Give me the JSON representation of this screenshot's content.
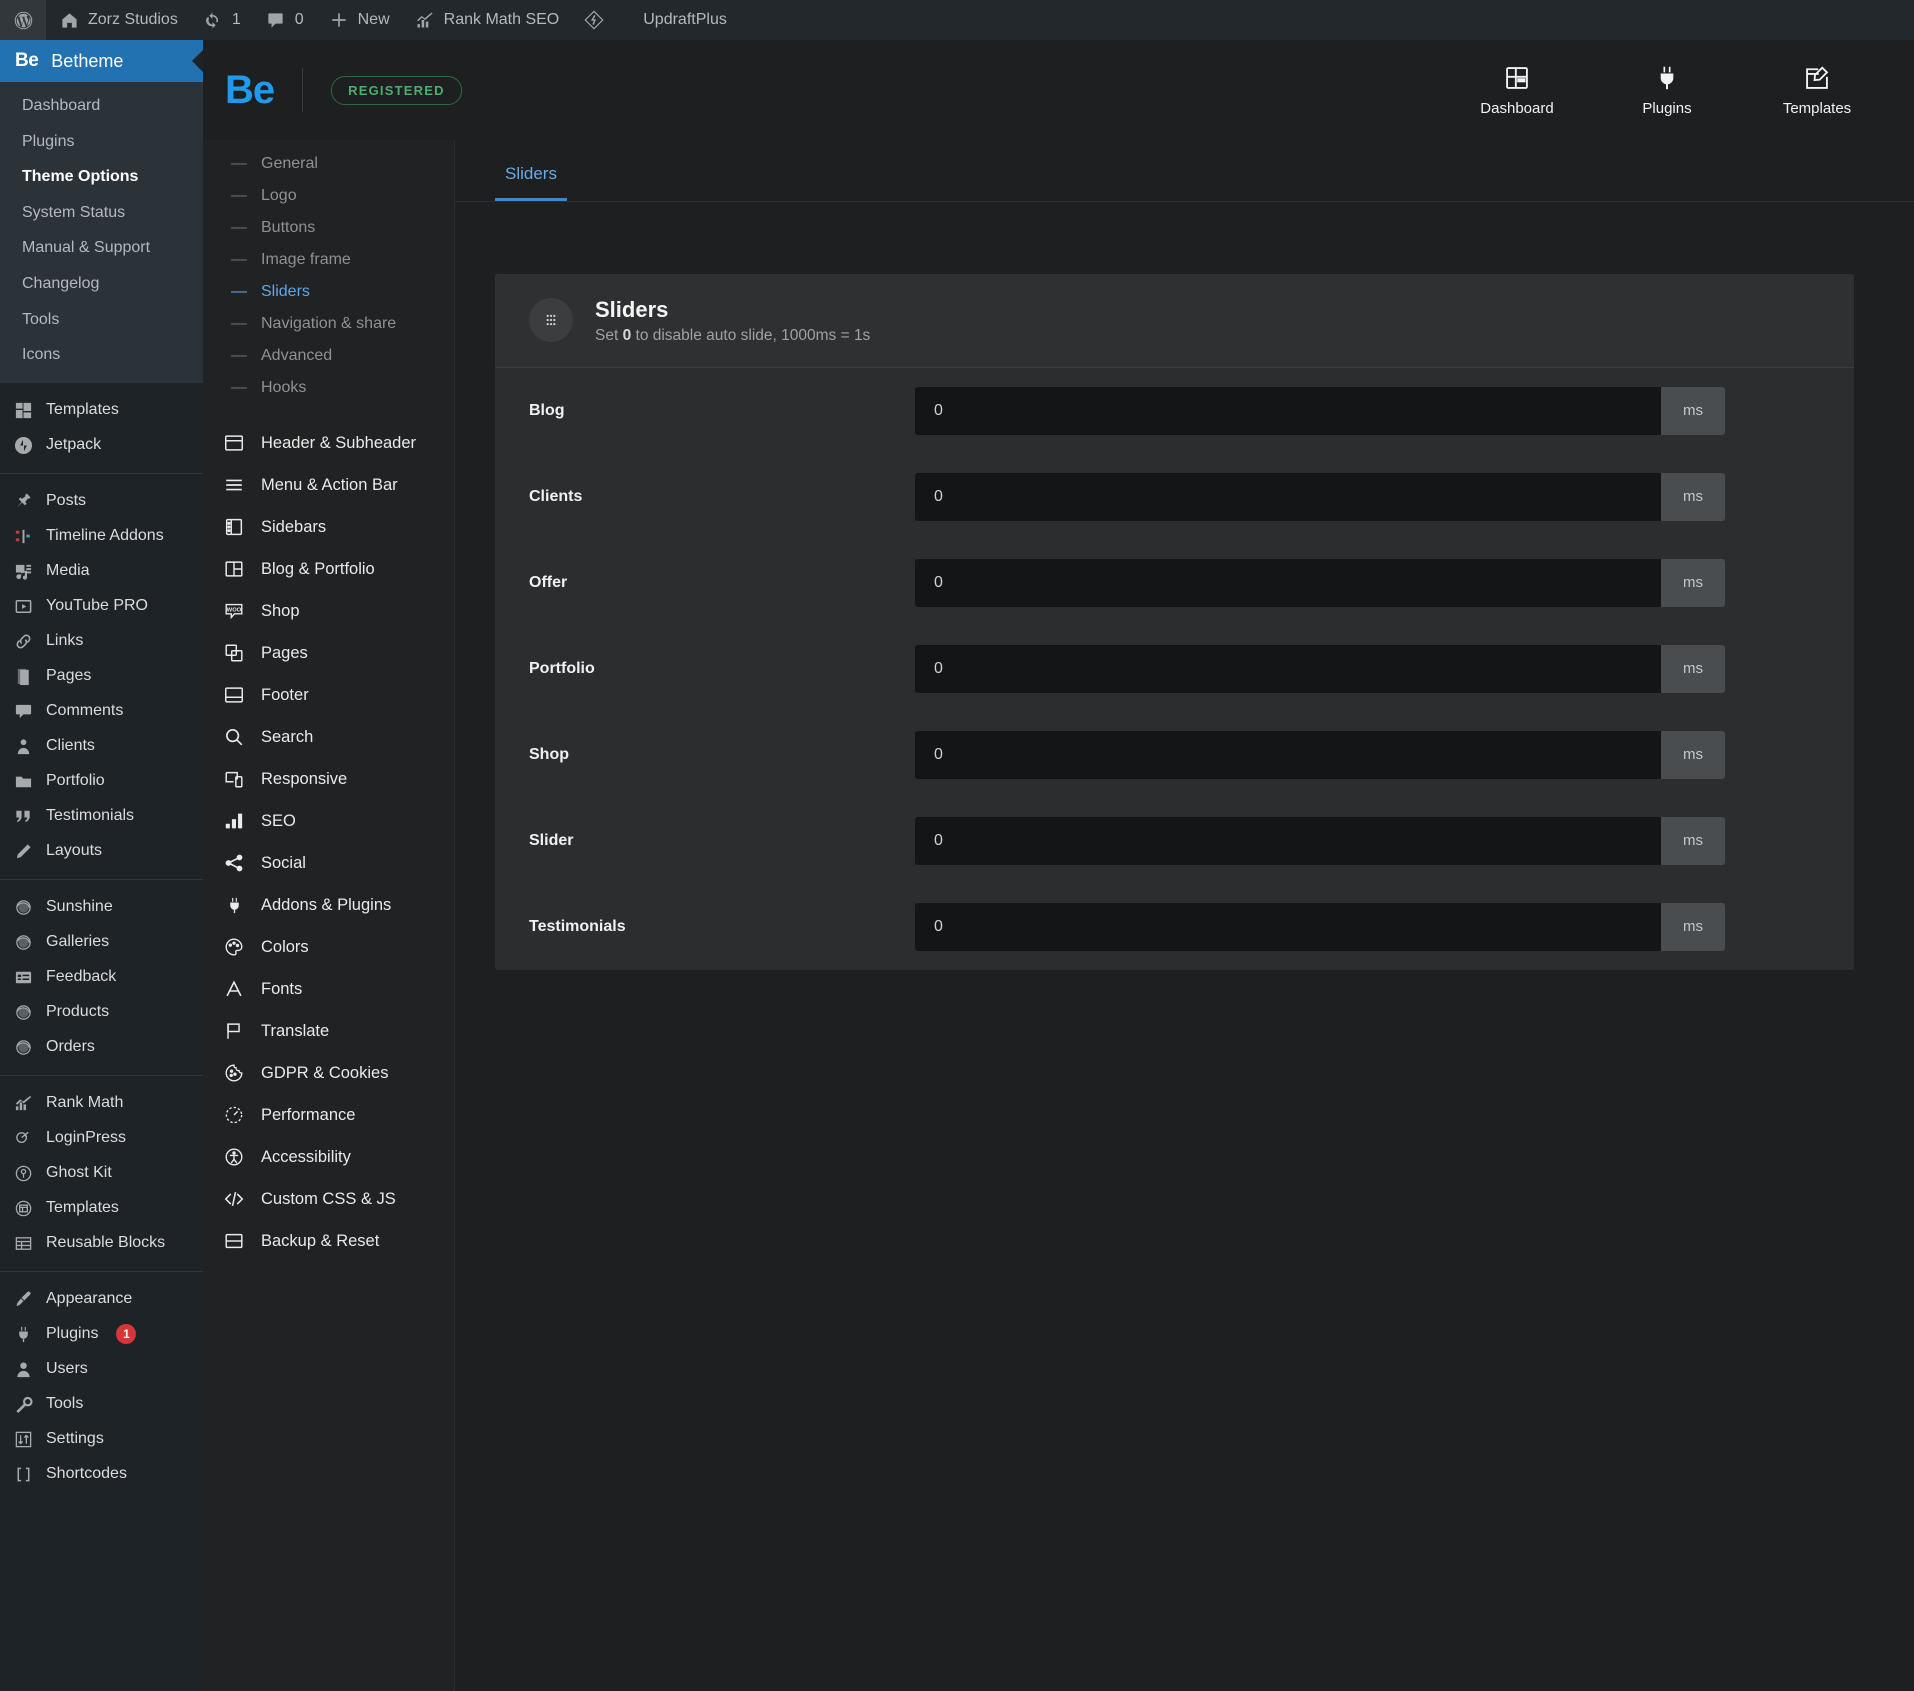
{
  "colors": {
    "accent": "#1e9bf0",
    "wp_blue": "#2271b1",
    "badge_green": "#4caf6d",
    "badge_red": "#d63638",
    "tab_active": "#6aabe6"
  },
  "adminbar": {
    "wp_logo": "wordpress-icon",
    "site_name": "Zorz Studios",
    "updates_count": "1",
    "comments_count": "0",
    "new_label": "New",
    "rank_math": "Rank Math SEO",
    "updraft": "UpdraftPlus"
  },
  "wpmenu": {
    "betheme": {
      "logo": "Be",
      "title": "Betheme",
      "items": [
        {
          "label": "Dashboard",
          "current": false
        },
        {
          "label": "Plugins",
          "current": false
        },
        {
          "label": "Theme Options",
          "current": true
        },
        {
          "label": "System Status",
          "current": false
        },
        {
          "label": "Manual & Support",
          "current": false
        },
        {
          "label": "Changelog",
          "current": false
        },
        {
          "label": "Tools",
          "current": false
        },
        {
          "label": "Icons",
          "current": false
        }
      ]
    },
    "groups": [
      {
        "items": [
          {
            "label": "Templates",
            "icon": "templates-icon",
            "badge": null
          },
          {
            "label": "Jetpack",
            "icon": "jetpack-icon",
            "badge": null
          }
        ]
      },
      {
        "items": [
          {
            "label": "Posts",
            "icon": "pin-icon",
            "badge": null
          },
          {
            "label": "Timeline Addons",
            "icon": "timeline-icon",
            "badge": null
          },
          {
            "label": "Media",
            "icon": "media-icon",
            "badge": null
          },
          {
            "label": "YouTube PRO",
            "icon": "video-icon",
            "badge": null
          },
          {
            "label": "Links",
            "icon": "link-icon",
            "badge": null
          },
          {
            "label": "Pages",
            "icon": "pages-icon",
            "badge": null
          },
          {
            "label": "Comments",
            "icon": "comment-icon",
            "badge": null
          },
          {
            "label": "Clients",
            "icon": "client-icon",
            "badge": null
          },
          {
            "label": "Portfolio",
            "icon": "portfolio-icon",
            "badge": null
          },
          {
            "label": "Testimonials",
            "icon": "quote-icon",
            "badge": null
          },
          {
            "label": "Layouts",
            "icon": "pencil-icon",
            "badge": null
          }
        ]
      },
      {
        "items": [
          {
            "label": "Sunshine",
            "icon": "circle-icon",
            "badge": null
          },
          {
            "label": "Galleries",
            "icon": "circle-icon",
            "badge": null
          },
          {
            "label": "Feedback",
            "icon": "feedback-icon",
            "badge": null
          },
          {
            "label": "Products",
            "icon": "circle-icon",
            "badge": null
          },
          {
            "label": "Orders",
            "icon": "circle-icon",
            "badge": null
          }
        ]
      },
      {
        "items": [
          {
            "label": "Rank Math",
            "icon": "rankmath-icon",
            "badge": null
          },
          {
            "label": "LoginPress",
            "icon": "loginpress-icon",
            "badge": null
          },
          {
            "label": "Ghost Kit",
            "icon": "ghostkit-icon",
            "badge": null
          },
          {
            "label": "Templates",
            "icon": "template-circle-icon",
            "badge": null
          },
          {
            "label": "Reusable Blocks",
            "icon": "blocks-icon",
            "badge": null
          }
        ]
      },
      {
        "items": [
          {
            "label": "Appearance",
            "icon": "brush-icon",
            "badge": null
          },
          {
            "label": "Plugins",
            "icon": "plug-icon",
            "badge": "1"
          },
          {
            "label": "Users",
            "icon": "user-icon",
            "badge": null
          },
          {
            "label": "Tools",
            "icon": "wrench-icon",
            "badge": null
          },
          {
            "label": "Settings",
            "icon": "settings-icon",
            "badge": null
          },
          {
            "label": "Shortcodes",
            "icon": "brackets-icon",
            "badge": null
          }
        ]
      }
    ]
  },
  "topbar": {
    "logo": "Be",
    "status_badge": "REGISTERED",
    "actions": [
      {
        "label": "Dashboard",
        "icon": "grid-icon"
      },
      {
        "label": "Plugins",
        "icon": "plug-icon"
      },
      {
        "label": "Templates",
        "icon": "edit-window-icon"
      }
    ]
  },
  "benav": {
    "subitems": [
      {
        "label": "General",
        "active": false
      },
      {
        "label": "Logo",
        "active": false
      },
      {
        "label": "Buttons",
        "active": false
      },
      {
        "label": "Image frame",
        "active": false
      },
      {
        "label": "Sliders",
        "active": true
      },
      {
        "label": "Navigation & share",
        "active": false
      },
      {
        "label": "Advanced",
        "active": false
      },
      {
        "label": "Hooks",
        "active": false
      }
    ],
    "items": [
      {
        "label": "Header & Subheader",
        "icon": "header-icon"
      },
      {
        "label": "Menu & Action Bar",
        "icon": "hamburger-icon"
      },
      {
        "label": "Sidebars",
        "icon": "sidebar-icon"
      },
      {
        "label": "Blog & Portfolio",
        "icon": "layout-split-icon"
      },
      {
        "label": "Shop",
        "icon": "woo-icon"
      },
      {
        "label": "Pages",
        "icon": "copy-icon"
      },
      {
        "label": "Footer",
        "icon": "footer-icon"
      },
      {
        "label": "Search",
        "icon": "search-icon"
      },
      {
        "label": "Responsive",
        "icon": "responsive-icon"
      },
      {
        "label": "SEO",
        "icon": "bars-icon"
      },
      {
        "label": "Social",
        "icon": "share-icon"
      },
      {
        "label": "Addons & Plugins",
        "icon": "plug-icon"
      },
      {
        "label": "Colors",
        "icon": "palette-icon"
      },
      {
        "label": "Fonts",
        "icon": "font-a-icon"
      },
      {
        "label": "Translate",
        "icon": "flag-icon"
      },
      {
        "label": "GDPR & Cookies",
        "icon": "cookie-icon"
      },
      {
        "label": "Performance",
        "icon": "gauge-icon"
      },
      {
        "label": "Accessibility",
        "icon": "accessibility-icon"
      },
      {
        "label": "Custom CSS & JS",
        "icon": "code-icon"
      },
      {
        "label": "Backup & Reset",
        "icon": "archive-icon"
      }
    ]
  },
  "main": {
    "tabs": [
      {
        "label": "Sliders",
        "active": true
      }
    ],
    "panel": {
      "icon": "dots-grid-icon",
      "title": "Sliders",
      "desc_prefix": "Set ",
      "desc_bold": "0",
      "desc_suffix": " to disable auto slide, 1000ms = 1s",
      "suffix_unit": "ms",
      "placeholder": "0",
      "rows": [
        {
          "label": "Blog",
          "value": "0",
          "unit": "ms"
        },
        {
          "label": "Clients",
          "value": "0",
          "unit": "ms"
        },
        {
          "label": "Offer",
          "value": "0",
          "unit": "ms"
        },
        {
          "label": "Portfolio",
          "value": "0",
          "unit": "ms"
        },
        {
          "label": "Shop",
          "value": "0",
          "unit": "ms"
        },
        {
          "label": "Slider",
          "value": "0",
          "unit": "ms"
        },
        {
          "label": "Testimonials",
          "value": "0",
          "unit": "ms"
        }
      ]
    }
  }
}
